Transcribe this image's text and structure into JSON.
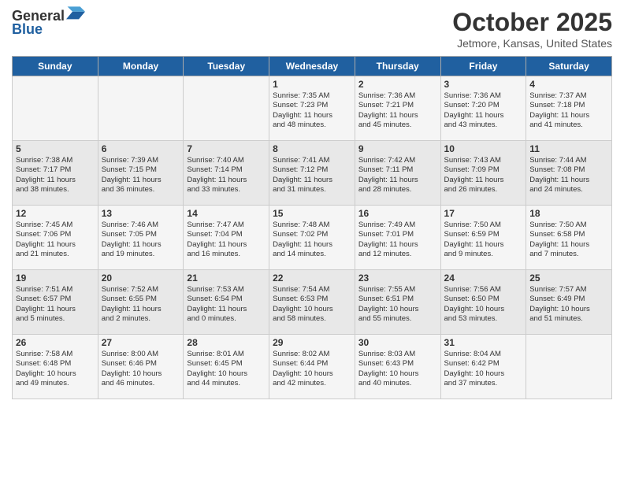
{
  "logo": {
    "line1": "General",
    "line2": "Blue"
  },
  "header": {
    "title": "October 2025",
    "location": "Jetmore, Kansas, United States"
  },
  "days_of_week": [
    "Sunday",
    "Monday",
    "Tuesday",
    "Wednesday",
    "Thursday",
    "Friday",
    "Saturday"
  ],
  "weeks": [
    [
      {
        "day": "",
        "info": ""
      },
      {
        "day": "",
        "info": ""
      },
      {
        "day": "",
        "info": ""
      },
      {
        "day": "1",
        "info": "Sunrise: 7:35 AM\nSunset: 7:23 PM\nDaylight: 11 hours\nand 48 minutes."
      },
      {
        "day": "2",
        "info": "Sunrise: 7:36 AM\nSunset: 7:21 PM\nDaylight: 11 hours\nand 45 minutes."
      },
      {
        "day": "3",
        "info": "Sunrise: 7:36 AM\nSunset: 7:20 PM\nDaylight: 11 hours\nand 43 minutes."
      },
      {
        "day": "4",
        "info": "Sunrise: 7:37 AM\nSunset: 7:18 PM\nDaylight: 11 hours\nand 41 minutes."
      }
    ],
    [
      {
        "day": "5",
        "info": "Sunrise: 7:38 AM\nSunset: 7:17 PM\nDaylight: 11 hours\nand 38 minutes."
      },
      {
        "day": "6",
        "info": "Sunrise: 7:39 AM\nSunset: 7:15 PM\nDaylight: 11 hours\nand 36 minutes."
      },
      {
        "day": "7",
        "info": "Sunrise: 7:40 AM\nSunset: 7:14 PM\nDaylight: 11 hours\nand 33 minutes."
      },
      {
        "day": "8",
        "info": "Sunrise: 7:41 AM\nSunset: 7:12 PM\nDaylight: 11 hours\nand 31 minutes."
      },
      {
        "day": "9",
        "info": "Sunrise: 7:42 AM\nSunset: 7:11 PM\nDaylight: 11 hours\nand 28 minutes."
      },
      {
        "day": "10",
        "info": "Sunrise: 7:43 AM\nSunset: 7:09 PM\nDaylight: 11 hours\nand 26 minutes."
      },
      {
        "day": "11",
        "info": "Sunrise: 7:44 AM\nSunset: 7:08 PM\nDaylight: 11 hours\nand 24 minutes."
      }
    ],
    [
      {
        "day": "12",
        "info": "Sunrise: 7:45 AM\nSunset: 7:06 PM\nDaylight: 11 hours\nand 21 minutes."
      },
      {
        "day": "13",
        "info": "Sunrise: 7:46 AM\nSunset: 7:05 PM\nDaylight: 11 hours\nand 19 minutes."
      },
      {
        "day": "14",
        "info": "Sunrise: 7:47 AM\nSunset: 7:04 PM\nDaylight: 11 hours\nand 16 minutes."
      },
      {
        "day": "15",
        "info": "Sunrise: 7:48 AM\nSunset: 7:02 PM\nDaylight: 11 hours\nand 14 minutes."
      },
      {
        "day": "16",
        "info": "Sunrise: 7:49 AM\nSunset: 7:01 PM\nDaylight: 11 hours\nand 12 minutes."
      },
      {
        "day": "17",
        "info": "Sunrise: 7:50 AM\nSunset: 6:59 PM\nDaylight: 11 hours\nand 9 minutes."
      },
      {
        "day": "18",
        "info": "Sunrise: 7:50 AM\nSunset: 6:58 PM\nDaylight: 11 hours\nand 7 minutes."
      }
    ],
    [
      {
        "day": "19",
        "info": "Sunrise: 7:51 AM\nSunset: 6:57 PM\nDaylight: 11 hours\nand 5 minutes."
      },
      {
        "day": "20",
        "info": "Sunrise: 7:52 AM\nSunset: 6:55 PM\nDaylight: 11 hours\nand 2 minutes."
      },
      {
        "day": "21",
        "info": "Sunrise: 7:53 AM\nSunset: 6:54 PM\nDaylight: 11 hours\nand 0 minutes."
      },
      {
        "day": "22",
        "info": "Sunrise: 7:54 AM\nSunset: 6:53 PM\nDaylight: 10 hours\nand 58 minutes."
      },
      {
        "day": "23",
        "info": "Sunrise: 7:55 AM\nSunset: 6:51 PM\nDaylight: 10 hours\nand 55 minutes."
      },
      {
        "day": "24",
        "info": "Sunrise: 7:56 AM\nSunset: 6:50 PM\nDaylight: 10 hours\nand 53 minutes."
      },
      {
        "day": "25",
        "info": "Sunrise: 7:57 AM\nSunset: 6:49 PM\nDaylight: 10 hours\nand 51 minutes."
      }
    ],
    [
      {
        "day": "26",
        "info": "Sunrise: 7:58 AM\nSunset: 6:48 PM\nDaylight: 10 hours\nand 49 minutes."
      },
      {
        "day": "27",
        "info": "Sunrise: 8:00 AM\nSunset: 6:46 PM\nDaylight: 10 hours\nand 46 minutes."
      },
      {
        "day": "28",
        "info": "Sunrise: 8:01 AM\nSunset: 6:45 PM\nDaylight: 10 hours\nand 44 minutes."
      },
      {
        "day": "29",
        "info": "Sunrise: 8:02 AM\nSunset: 6:44 PM\nDaylight: 10 hours\nand 42 minutes."
      },
      {
        "day": "30",
        "info": "Sunrise: 8:03 AM\nSunset: 6:43 PM\nDaylight: 10 hours\nand 40 minutes."
      },
      {
        "day": "31",
        "info": "Sunrise: 8:04 AM\nSunset: 6:42 PM\nDaylight: 10 hours\nand 37 minutes."
      },
      {
        "day": "",
        "info": ""
      }
    ]
  ]
}
